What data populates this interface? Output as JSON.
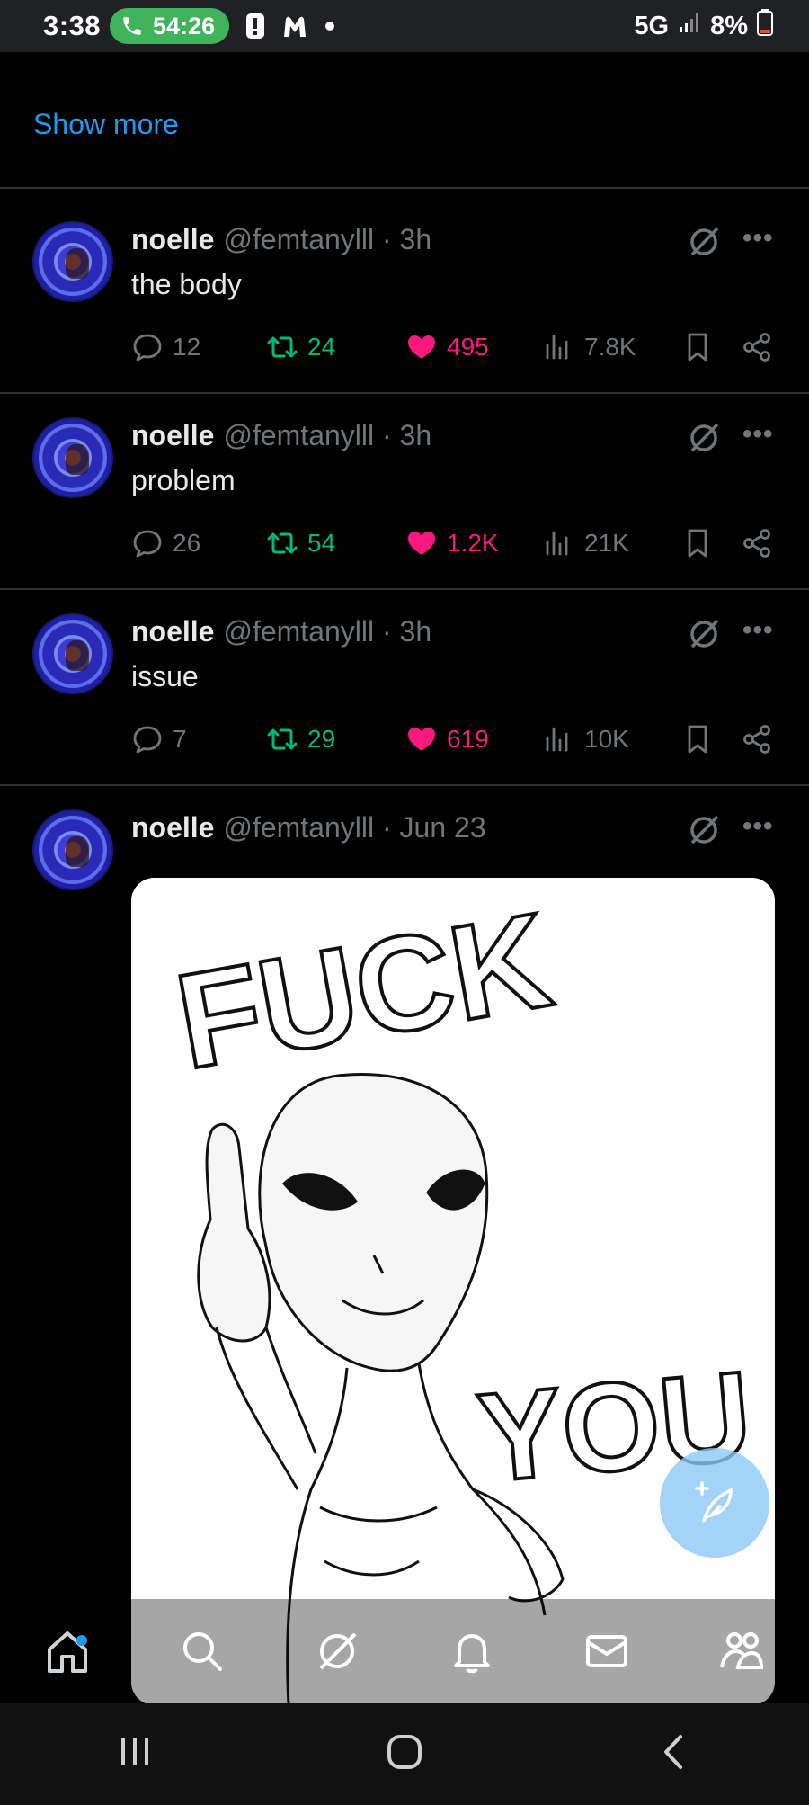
{
  "status_bar": {
    "time": "3:38",
    "call_timer": "54:26",
    "network": "5G",
    "battery": "8%",
    "icons": [
      "phone-icon",
      "alert-icon",
      "malwarebytes-icon",
      "dot-icon",
      "signal-icon",
      "battery-icon"
    ]
  },
  "feed": {
    "show_more": "Show more",
    "posts": [
      {
        "name": "noelle",
        "handle": "@femtanylll · 3h",
        "text": "the body",
        "replies": "12",
        "reposts": "24",
        "likes": "495",
        "views": "7.8K"
      },
      {
        "name": "noelle",
        "handle": "@femtanylll · 3h",
        "text": "problem",
        "replies": "26",
        "reposts": "54",
        "likes": "1.2K",
        "views": "21K"
      },
      {
        "name": "noelle",
        "handle": "@femtanylll · 3h",
        "text": "issue",
        "replies": "7",
        "reposts": "29",
        "likes": "619",
        "views": "10K"
      },
      {
        "name": "noelle",
        "handle": "@femtanylll · Jun 23",
        "media": {
          "top_word": "FUCK",
          "bottom_word": "YOU"
        }
      }
    ]
  },
  "bottom_nav": [
    "home-icon",
    "search-icon",
    "grok-icon",
    "notifications-icon",
    "messages-icon",
    "communities-icon"
  ],
  "system_nav": [
    "recents-icon",
    "home-circle-icon",
    "back-icon"
  ],
  "colors": {
    "accent": "#1d9bf0",
    "repost": "#00ba7c",
    "like": "#f91880",
    "muted": "#71767b",
    "call_pill": "#3fb45a"
  }
}
